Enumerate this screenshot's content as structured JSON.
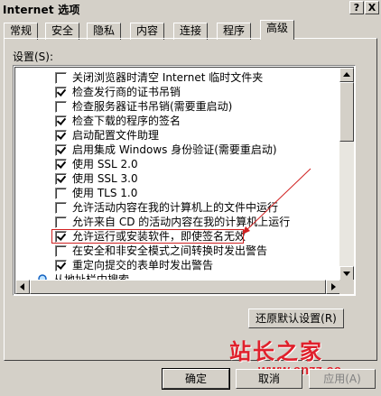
{
  "window": {
    "title": "Internet 选项",
    "help_label": "?",
    "close_label": "X"
  },
  "tabs": [
    {
      "label": "常规"
    },
    {
      "label": "安全"
    },
    {
      "label": "隐私"
    },
    {
      "label": "内容"
    },
    {
      "label": "连接"
    },
    {
      "label": "程序"
    },
    {
      "label": "高级"
    }
  ],
  "active_tab": "高级",
  "settings": {
    "label": "设置(S):",
    "items": [
      {
        "label": "关闭浏览器时清空 Internet 临时文件夹",
        "checked": false
      },
      {
        "label": "检查发行商的证书吊销",
        "checked": true
      },
      {
        "label": "检查服务器证书吊销(需要重启动)",
        "checked": false
      },
      {
        "label": "检查下载的程序的签名",
        "checked": true
      },
      {
        "label": "启动配置文件助理",
        "checked": true
      },
      {
        "label": "启用集成 Windows 身份验证(需要重启动)",
        "checked": true
      },
      {
        "label": "使用 SSL 2.0",
        "checked": true
      },
      {
        "label": "使用 SSL 3.0",
        "checked": true
      },
      {
        "label": "使用 TLS 1.0",
        "checked": false
      },
      {
        "label": "允许活动内容在我的计算机上的文件中运行",
        "checked": false
      },
      {
        "label": "允许来自 CD 的活动内容在我的计算机上运行",
        "checked": false
      },
      {
        "label": "允许运行或安装软件，即使签名无效",
        "checked": true
      },
      {
        "label": "在安全和非安全模式之间转换时发出警告",
        "checked": false
      },
      {
        "label": "重定向提交的表单时发出警告",
        "checked": true
      },
      {
        "label": "从地址栏中搜索",
        "checked": null
      }
    ]
  },
  "restore_button": "还原默认设置(R)",
  "buttons": {
    "ok": "确定",
    "cancel": "取消",
    "apply": "应用(A)"
  },
  "watermark": {
    "name": "站长之家",
    "url": "www.cnzz.cc"
  },
  "colors": {
    "face": "#d4d0c8",
    "annotation": "#d02020",
    "watermark": "#e0202b"
  }
}
